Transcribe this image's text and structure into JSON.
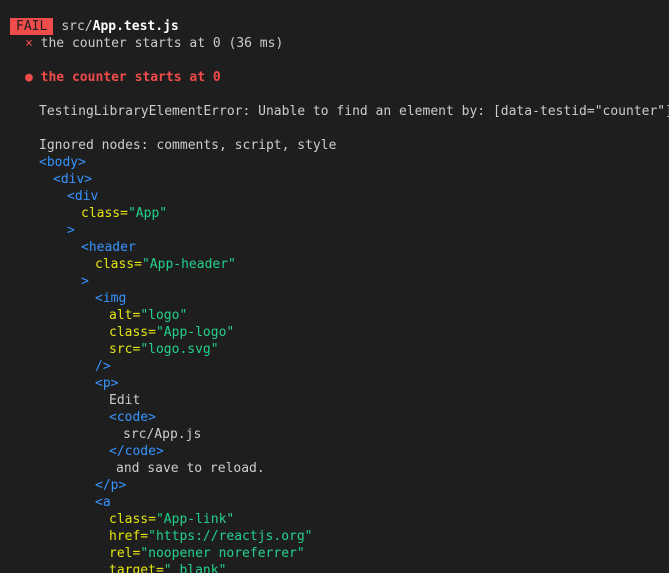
{
  "header": {
    "badge": "FAIL",
    "path_dir": "src/",
    "path_file": "App.test.js"
  },
  "summary": {
    "mark": "×",
    "text": "the counter starts at 0 (36 ms)"
  },
  "test": {
    "bullet": "●",
    "title": "the counter starts at 0"
  },
  "error": {
    "message": "TestingLibraryElementError: Unable to find an element by: [data-testid=\"counter\"]"
  },
  "ignored": {
    "text": "Ignored nodes: comments, script, style"
  },
  "dom": {
    "body_open": "<body>",
    "div_open": "<div>",
    "div_app_open": "<div",
    "attr_class": "class=",
    "val_app": "\"App\"",
    "gt": ">",
    "header_open": "<header",
    "val_app_header": "\"App-header\"",
    "img_open": "<img",
    "attr_alt": "alt=",
    "val_logo": "\"logo\"",
    "val_app_logo": "\"App-logo\"",
    "attr_src": "src=",
    "val_logo_svg": "\"logo.svg\"",
    "self_close": "/>",
    "p_open": "<p>",
    "text_edit": "Edit",
    "code_open": "<code>",
    "text_src": "src/App.js",
    "code_close": "</code>",
    "text_save": "and save to reload.",
    "p_close": "</p>",
    "a_open": "<a",
    "val_app_link": "\"App-link\"",
    "attr_href": "href=",
    "val_href": "\"https://reactjs.org\"",
    "attr_rel": "rel=",
    "val_rel": "\"noopener noreferrer\"",
    "attr_target": "target=",
    "val_target": "\"_blank\""
  }
}
